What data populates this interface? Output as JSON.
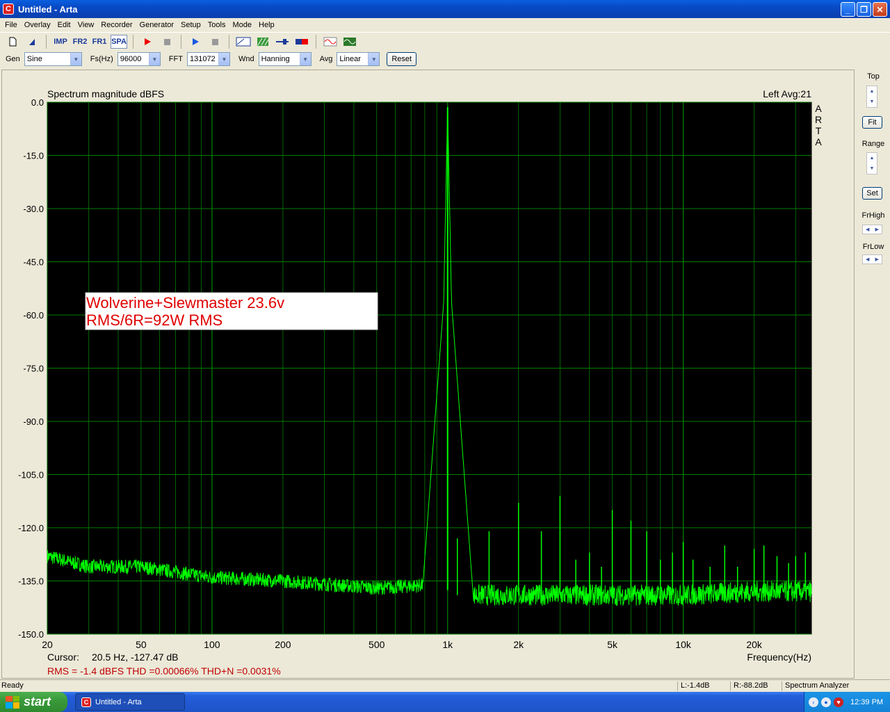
{
  "window": {
    "title": "Untitled - Arta",
    "app_icon_letter": "C",
    "min": "_",
    "max": "❐",
    "close": "✕"
  },
  "menu": [
    "File",
    "Overlay",
    "Edit",
    "View",
    "Recorder",
    "Generator",
    "Setup",
    "Tools",
    "Mode",
    "Help"
  ],
  "toolbar": {
    "imp": "IMP",
    "fr2": "FR2",
    "fr1": "FR1",
    "spa": "SPA"
  },
  "controls": {
    "gen_label": "Gen",
    "gen_value": "Sine",
    "fs_label": "Fs(Hz)",
    "fs_value": "96000",
    "fft_label": "FFT",
    "fft_value": "131072",
    "wnd_label": "Wnd",
    "wnd_value": "Hanning",
    "avg_label": "Avg",
    "avg_value": "Linear",
    "reset": "Reset"
  },
  "right_panel": {
    "top": "Top",
    "fit": "Fit",
    "range": "Range",
    "set": "Set",
    "frhigh": "FrHigh",
    "frlow": "FrLow"
  },
  "plot": {
    "title": "Spectrum magnitude dBFS",
    "channel_avg": "Left  Avg:21",
    "arta_vertical": [
      "A",
      "R",
      "T",
      "A"
    ],
    "xlabel": "Frequency(Hz)",
    "annotation_line1": "Wolverine+Slewmaster 23.6v",
    "annotation_line2": "RMS/6R=92W RMS",
    "cursor_label": "Cursor:",
    "cursor_value": "20.5 Hz, -127.47 dB",
    "rms_line": "RMS =   -1.4 dBFS   THD =0.00066%   THD+N =0.0031%"
  },
  "status": {
    "left": "Ready",
    "l": "L:-1.4dB",
    "r": "R:-88.2dB",
    "mode": "Spectrum Analyzer"
  },
  "taskbar": {
    "start": "start",
    "task": "Untitled - Arta",
    "clock": "12:39 PM"
  },
  "colors": {
    "trace": "#00ff00",
    "grid": "#007f00",
    "plot_bg": "#000000",
    "annotation": "#e00000"
  },
  "chart_data": {
    "type": "line",
    "title": "Spectrum magnitude dBFS",
    "xlabel": "Frequency(Hz)",
    "ylabel": "",
    "x_scale": "log",
    "xlim": [
      20,
      35000
    ],
    "ylim": [
      -150,
      0
    ],
    "x_ticks": [
      20,
      50,
      100,
      200,
      500,
      1000,
      2000,
      5000,
      10000,
      20000
    ],
    "x_tick_labels": [
      "20",
      "50",
      "100",
      "200",
      "500",
      "1k",
      "2k",
      "5k",
      "10k",
      "20k"
    ],
    "y_ticks": [
      0,
      -15,
      -30,
      -45,
      -60,
      -75,
      -90,
      -105,
      -120,
      -135,
      -150
    ],
    "y_tick_labels": [
      "0.0",
      "-15.0",
      "-30.0",
      "-45.0",
      "-60.0",
      "-75.0",
      "-90.0",
      "-105.0",
      "-120.0",
      "-135.0",
      "-150.0"
    ],
    "grid": true,
    "series": [
      {
        "noise_floor": [
          [
            20,
            -128
          ],
          [
            30,
            -131
          ],
          [
            50,
            -131
          ],
          [
            100,
            -134
          ],
          [
            200,
            -135
          ],
          [
            500,
            -137
          ],
          [
            900,
            -136
          ],
          [
            1100,
            -139
          ],
          [
            2000,
            -139
          ],
          [
            5000,
            -139
          ],
          [
            10000,
            -139
          ],
          [
            20000,
            -138
          ],
          [
            35000,
            -138
          ]
        ],
        "fundamental": {
          "x": 1000,
          "y": -1.4
        },
        "harmonics": [
          [
            1100,
            -123
          ],
          [
            1500,
            -121
          ],
          [
            2000,
            -113
          ],
          [
            2500,
            -121
          ],
          [
            3000,
            -111
          ],
          [
            3500,
            -129
          ],
          [
            4000,
            -127
          ],
          [
            4500,
            -131
          ],
          [
            5000,
            -115
          ],
          [
            6000,
            -118
          ],
          [
            7000,
            -121
          ],
          [
            8000,
            -129
          ],
          [
            9000,
            -127
          ],
          [
            10000,
            -124
          ],
          [
            11000,
            -129
          ],
          [
            13000,
            -131
          ],
          [
            15000,
            -125
          ],
          [
            17000,
            -131
          ],
          [
            20000,
            -126
          ],
          [
            22000,
            -125
          ],
          [
            25000,
            -128
          ],
          [
            28000,
            -130
          ],
          [
            30000,
            -128
          ],
          [
            33000,
            -127
          ]
        ]
      }
    ]
  }
}
